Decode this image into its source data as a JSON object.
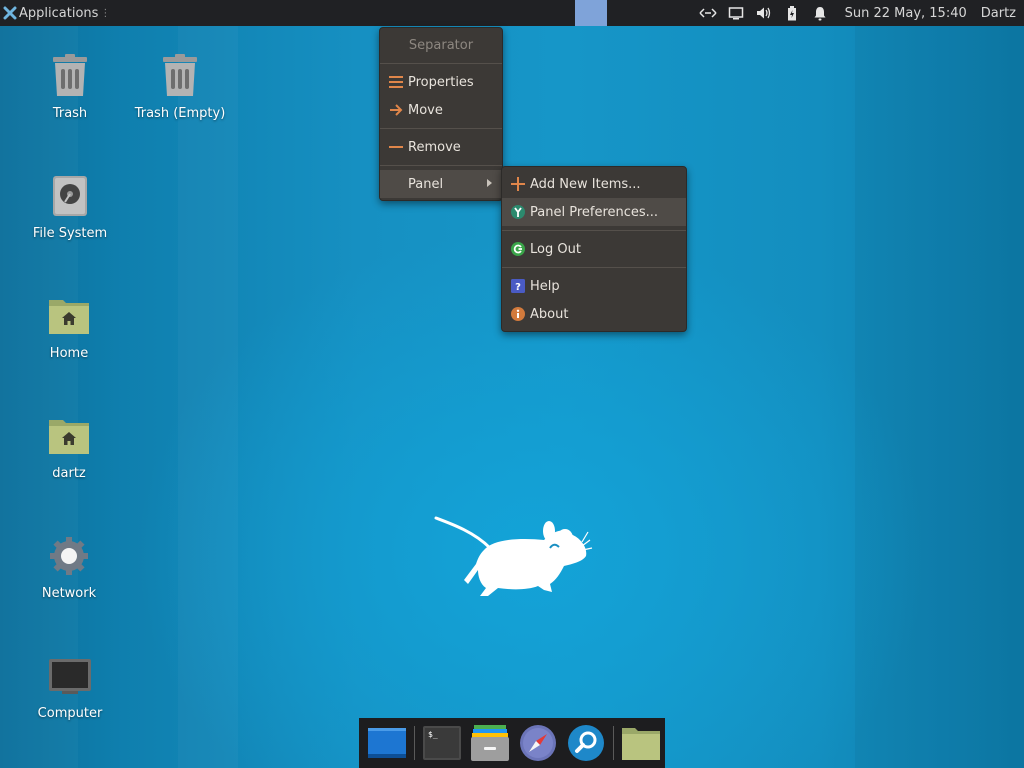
{
  "panel": {
    "applications_label": "Applications",
    "clock": "Sun 22 May, 15:40",
    "user": "Dartz",
    "tray_icons": [
      "network-arrows-icon",
      "display-icon",
      "volume-icon",
      "battery-icon",
      "notification-bell-icon"
    ]
  },
  "desktop": {
    "icons": [
      {
        "name": "trash",
        "label": "Trash"
      },
      {
        "name": "trash-empty",
        "label": "Trash (Empty)"
      },
      {
        "name": "file-system",
        "label": "File System"
      },
      {
        "name": "home",
        "label": "Home"
      },
      {
        "name": "dartz",
        "label": "dartz"
      },
      {
        "name": "network",
        "label": "Network"
      },
      {
        "name": "computer",
        "label": "Computer"
      }
    ]
  },
  "context_menu": {
    "title": "Separator",
    "properties": "Properties",
    "move": "Move",
    "remove": "Remove",
    "panel": "Panel"
  },
  "submenu": {
    "add_new_items": "Add New Items...",
    "panel_preferences": "Panel Preferences...",
    "log_out": "Log Out",
    "help": "Help",
    "about": "About"
  },
  "dock": {
    "items": [
      "desktop-icon",
      "terminal-icon",
      "file-manager-icon",
      "web-browser-icon",
      "app-finder-icon",
      "folder-icon"
    ]
  },
  "colors": {
    "desktop_blue": "#1690c2",
    "panel_bg": "#202124",
    "menu_bg": "#3c3936",
    "accent_orange": "#e0864a",
    "folder_green": "#b5c27a"
  }
}
